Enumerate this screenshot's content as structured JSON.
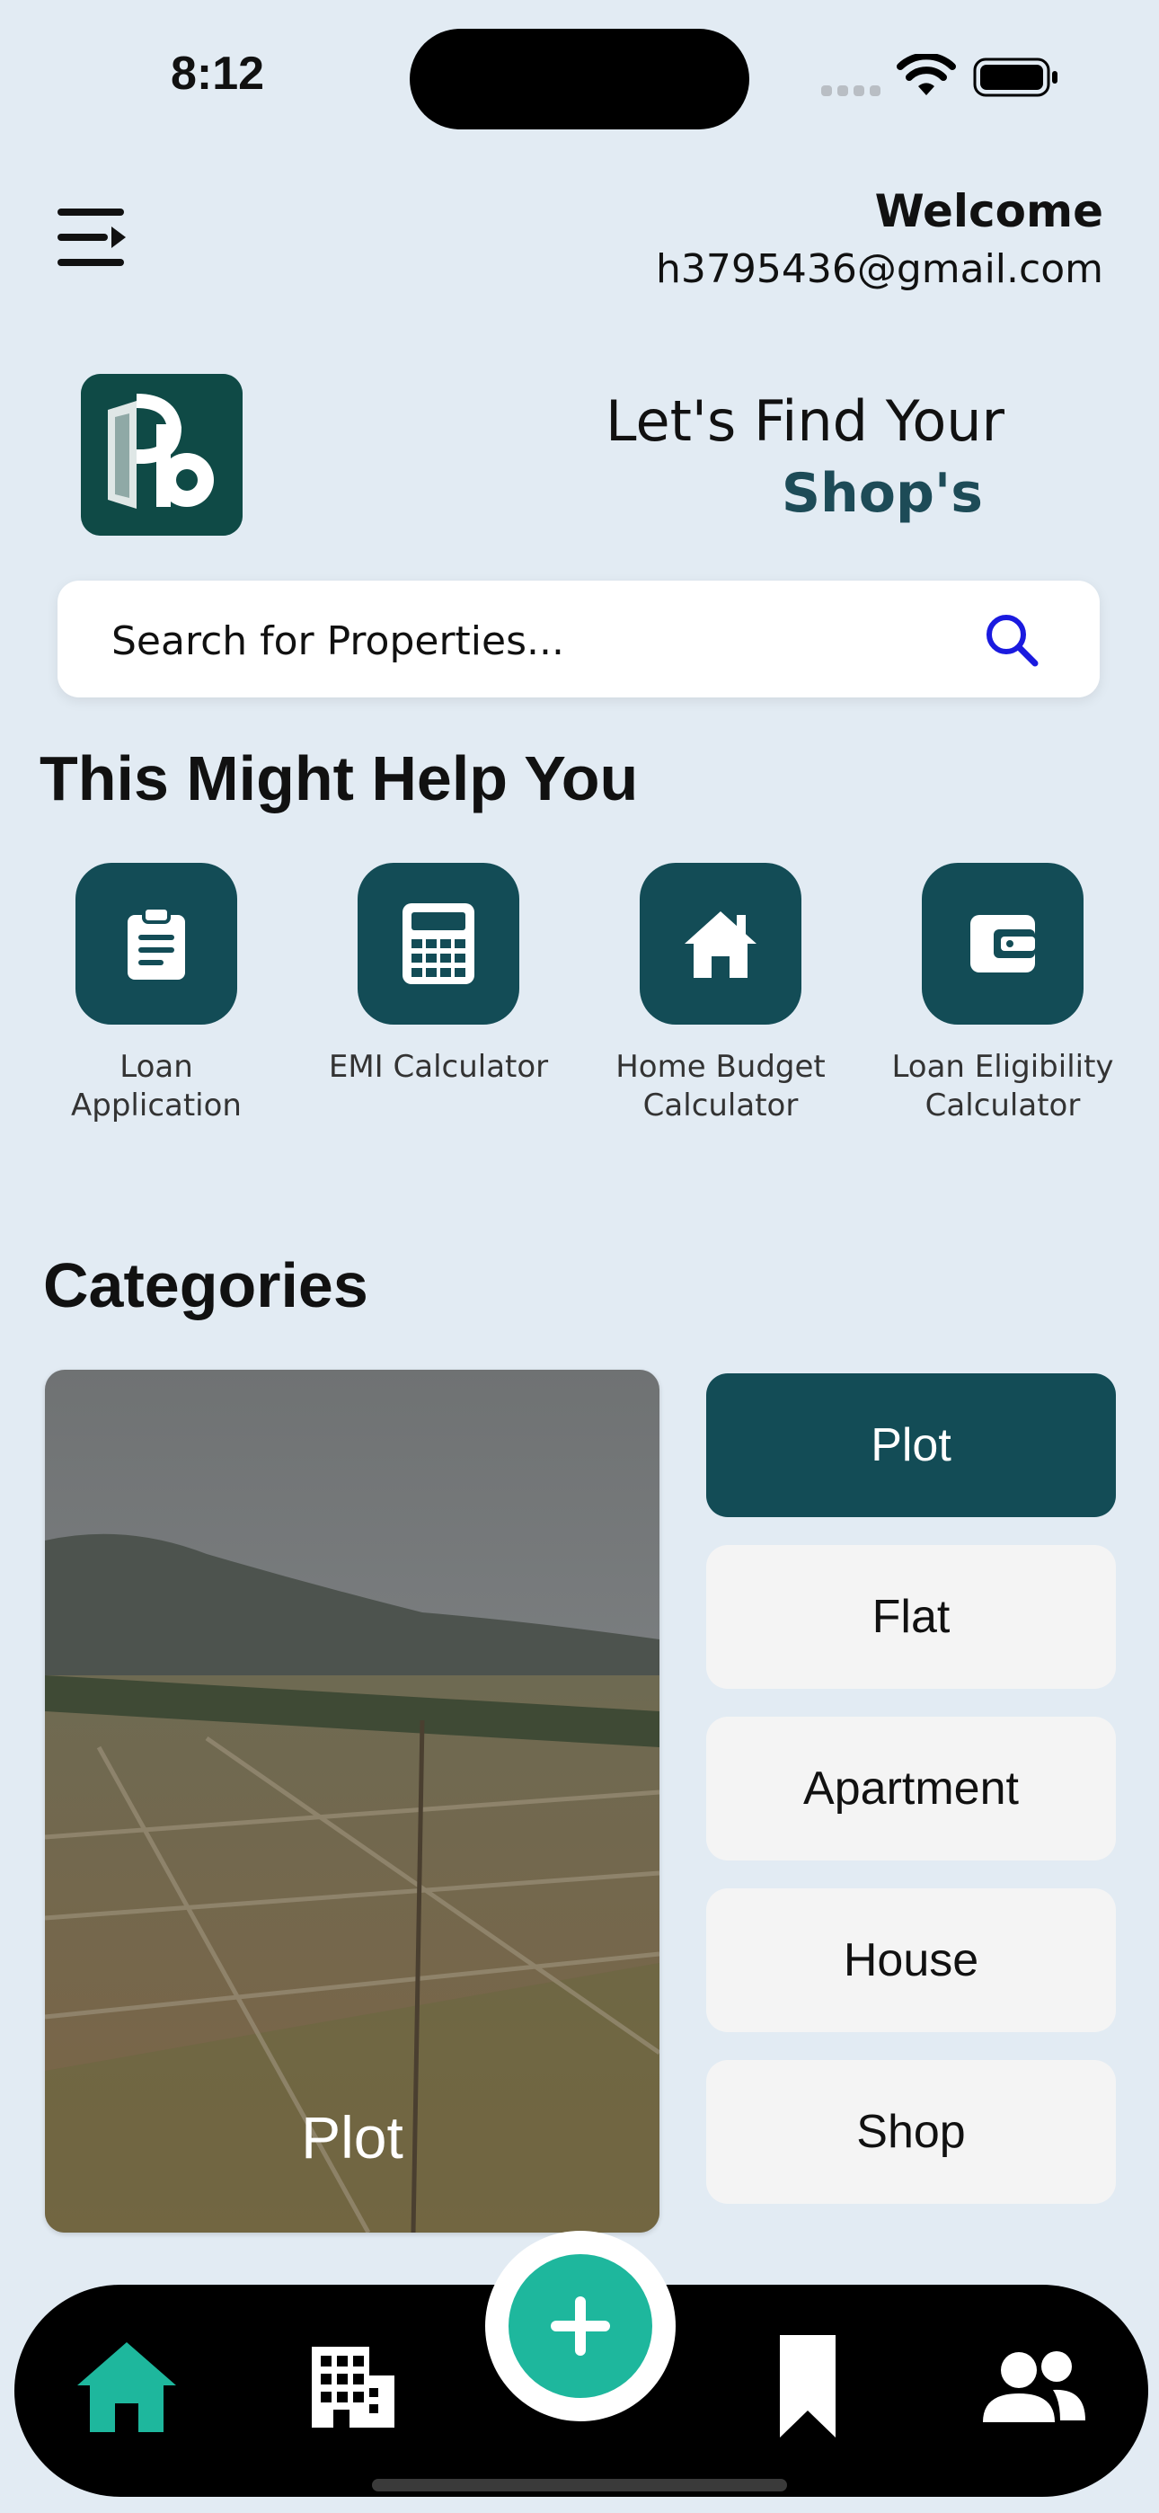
{
  "status_bar": {
    "time": "8:12"
  },
  "header": {
    "welcome": "Welcome",
    "email": "h3795436@gmail.com",
    "tagline_line1": "Let's Find Your",
    "tagline_line2": "Shop's"
  },
  "search": {
    "placeholder": "Search for Properties..."
  },
  "help_section": {
    "title": "This Might Help You",
    "items": [
      {
        "label": "Loan Application",
        "icon": "clipboard-icon"
      },
      {
        "label": "EMI Calculator",
        "icon": "calculator-icon"
      },
      {
        "label": "Home Budget Calculator",
        "icon": "home-icon"
      },
      {
        "label": "Loan Eligibility Calculator",
        "icon": "wallet-icon"
      }
    ]
  },
  "categories": {
    "title": "Categories",
    "featured_caption": "Plot",
    "items": [
      {
        "label": "Plot",
        "active": true
      },
      {
        "label": "Flat",
        "active": false
      },
      {
        "label": "Apartment",
        "active": false
      },
      {
        "label": "House",
        "active": false
      },
      {
        "label": "Shop",
        "active": false
      }
    ]
  },
  "bottom_nav": {
    "items": [
      "home-icon",
      "buildings-icon",
      "add-icon",
      "bookmark-icon",
      "users-icon"
    ]
  },
  "colors": {
    "background": "#e2ebf3",
    "primary": "#134c56",
    "accent": "#1eb79d",
    "search_icon": "#1a1adf"
  }
}
